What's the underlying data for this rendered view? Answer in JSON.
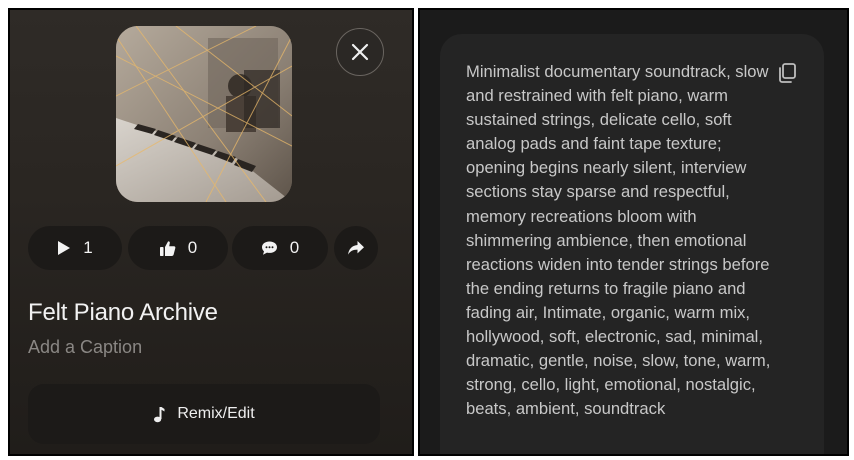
{
  "track": {
    "title": "Felt Piano Archive",
    "caption_placeholder": "Add a Caption"
  },
  "stats": {
    "plays": "1",
    "likes": "0",
    "comments": "0"
  },
  "actions": {
    "remix_label": "Remix/Edit"
  },
  "icons": {
    "close": "close-icon",
    "play": "play-icon",
    "like": "thumbs-up-icon",
    "comment": "comment-icon",
    "share": "share-icon",
    "music": "music-note-icon",
    "copy": "copy-icon"
  },
  "description": {
    "text": "Minimalist documentary soundtrack, slow and restrained with felt piano, warm sustained strings, delicate cello, soft analog pads and faint tape texture; opening begins nearly silent, interview sections stay sparse and respectful, memory recreations bloom with shimmering ambience, then emotional reactions widen into tender strings before the ending returns to fragile piano and fading air, Intimate, organic, warm mix, hollywood, soft, electronic, sad, minimal, dramatic, gentle, noise, slow, tone, warm, strong, cello, light, emotional, nostalgic, beats, ambient, soundtrack"
  },
  "colors": {
    "panel_bg": "#2a2622",
    "button_bg": "#1c1a18",
    "text_primary": "#f2f2f2",
    "text_muted": "#8a8784",
    "card_bg": "#242424"
  }
}
